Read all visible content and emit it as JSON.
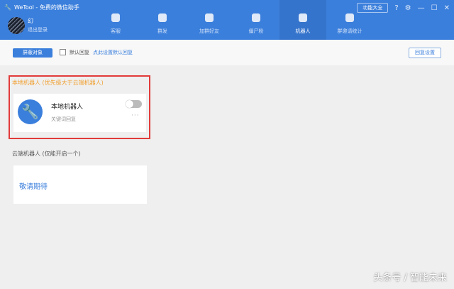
{
  "window": {
    "title": "WeTool - 免费的微信助手",
    "func_button": "功能大全"
  },
  "user": {
    "name": "幻",
    "logout": "退出登录"
  },
  "nav": [
    {
      "label": "客服"
    },
    {
      "label": "群发"
    },
    {
      "label": "加群好友"
    },
    {
      "label": "僵尸粉"
    },
    {
      "label": "机器人"
    },
    {
      "label": "群邀请统计"
    }
  ],
  "toolbar": {
    "block_button": "屏蔽对象",
    "default_reply": "默认回复",
    "set_default_link": "点此设置默认回复",
    "reply_settings": "回复设置"
  },
  "local": {
    "section_label": "本地机器人 (优先级大于云端机器人)",
    "card_title": "本地机器人",
    "card_sub": "关键词回复",
    "more": "···",
    "enabled": false
  },
  "cloud": {
    "section_label": "云端机器人 (仅能开启一个)",
    "coming": "敬请期待"
  },
  "watermark": "头条号 / 智能未来"
}
